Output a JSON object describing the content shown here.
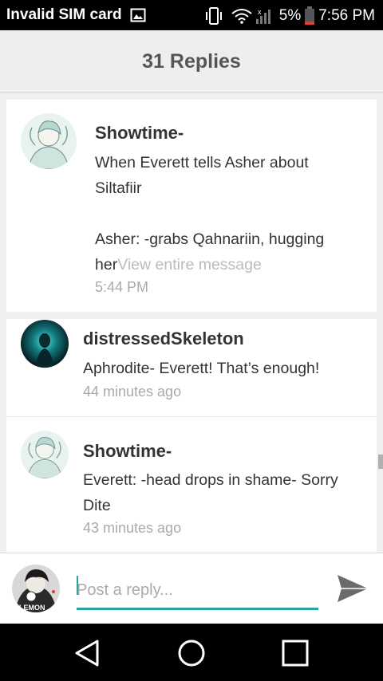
{
  "status_bar": {
    "carrier": "Invalid SIM card",
    "battery": "5%",
    "time": "7:56 PM",
    "icons": [
      "image-icon",
      "vibrate-icon",
      "wifi-icon",
      "signal-icon",
      "battery-icon"
    ]
  },
  "header": {
    "title": "31 Replies"
  },
  "replies": [
    {
      "author": "Showtime-",
      "lines": [
        "When Everett tells Asher about",
        "Siltafiir",
        "",
        "Asher: -grabs Qahnariin, hugging"
      ],
      "last_line": "her",
      "view_more": "View entire message",
      "time": "5:44 PM"
    },
    {
      "author": "distressedSkeleton",
      "lines": [
        "Aphrodite- Everett! That’s enough!"
      ],
      "time": "44 minutes ago"
    },
    {
      "author": "Showtime-",
      "lines": [
        "Everett: -head drops in shame- Sorry",
        "Dite"
      ],
      "time": "43 minutes ago"
    }
  ],
  "reply_bar": {
    "placeholder": "Post a reply..."
  },
  "colors": {
    "accent": "#2aa49a",
    "status_bar": "#000000",
    "header_bg": "#eeeeee"
  },
  "nav": {
    "icons": [
      "back-icon",
      "home-icon",
      "recents-icon"
    ]
  }
}
